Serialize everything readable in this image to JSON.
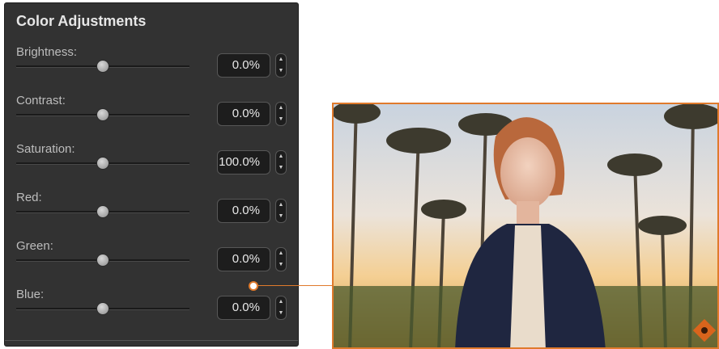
{
  "panel": {
    "title": "Color Adjustments",
    "rows": [
      {
        "label": "Brightness:",
        "value": "0.0%",
        "level": 0.5
      },
      {
        "label": "Contrast:",
        "value": "0.0%",
        "level": 0.5
      },
      {
        "label": "Saturation:",
        "value": "100.0%",
        "level": 0.5
      },
      {
        "label": "Red:",
        "value": "0.0%",
        "level": 0.5
      },
      {
        "label": "Green:",
        "value": "0.0%",
        "level": 0.5
      },
      {
        "label": "Blue:",
        "value": "0.0%",
        "level": 0.5
      }
    ]
  },
  "colors": {
    "panel_bg": "#323232",
    "accent": "#e07a2c",
    "text": "#e6e6e6"
  },
  "icons": {
    "stepper_up": "chevron-up-icon",
    "stepper_down": "chevron-down-icon",
    "badge": "diamond-badge-icon"
  }
}
